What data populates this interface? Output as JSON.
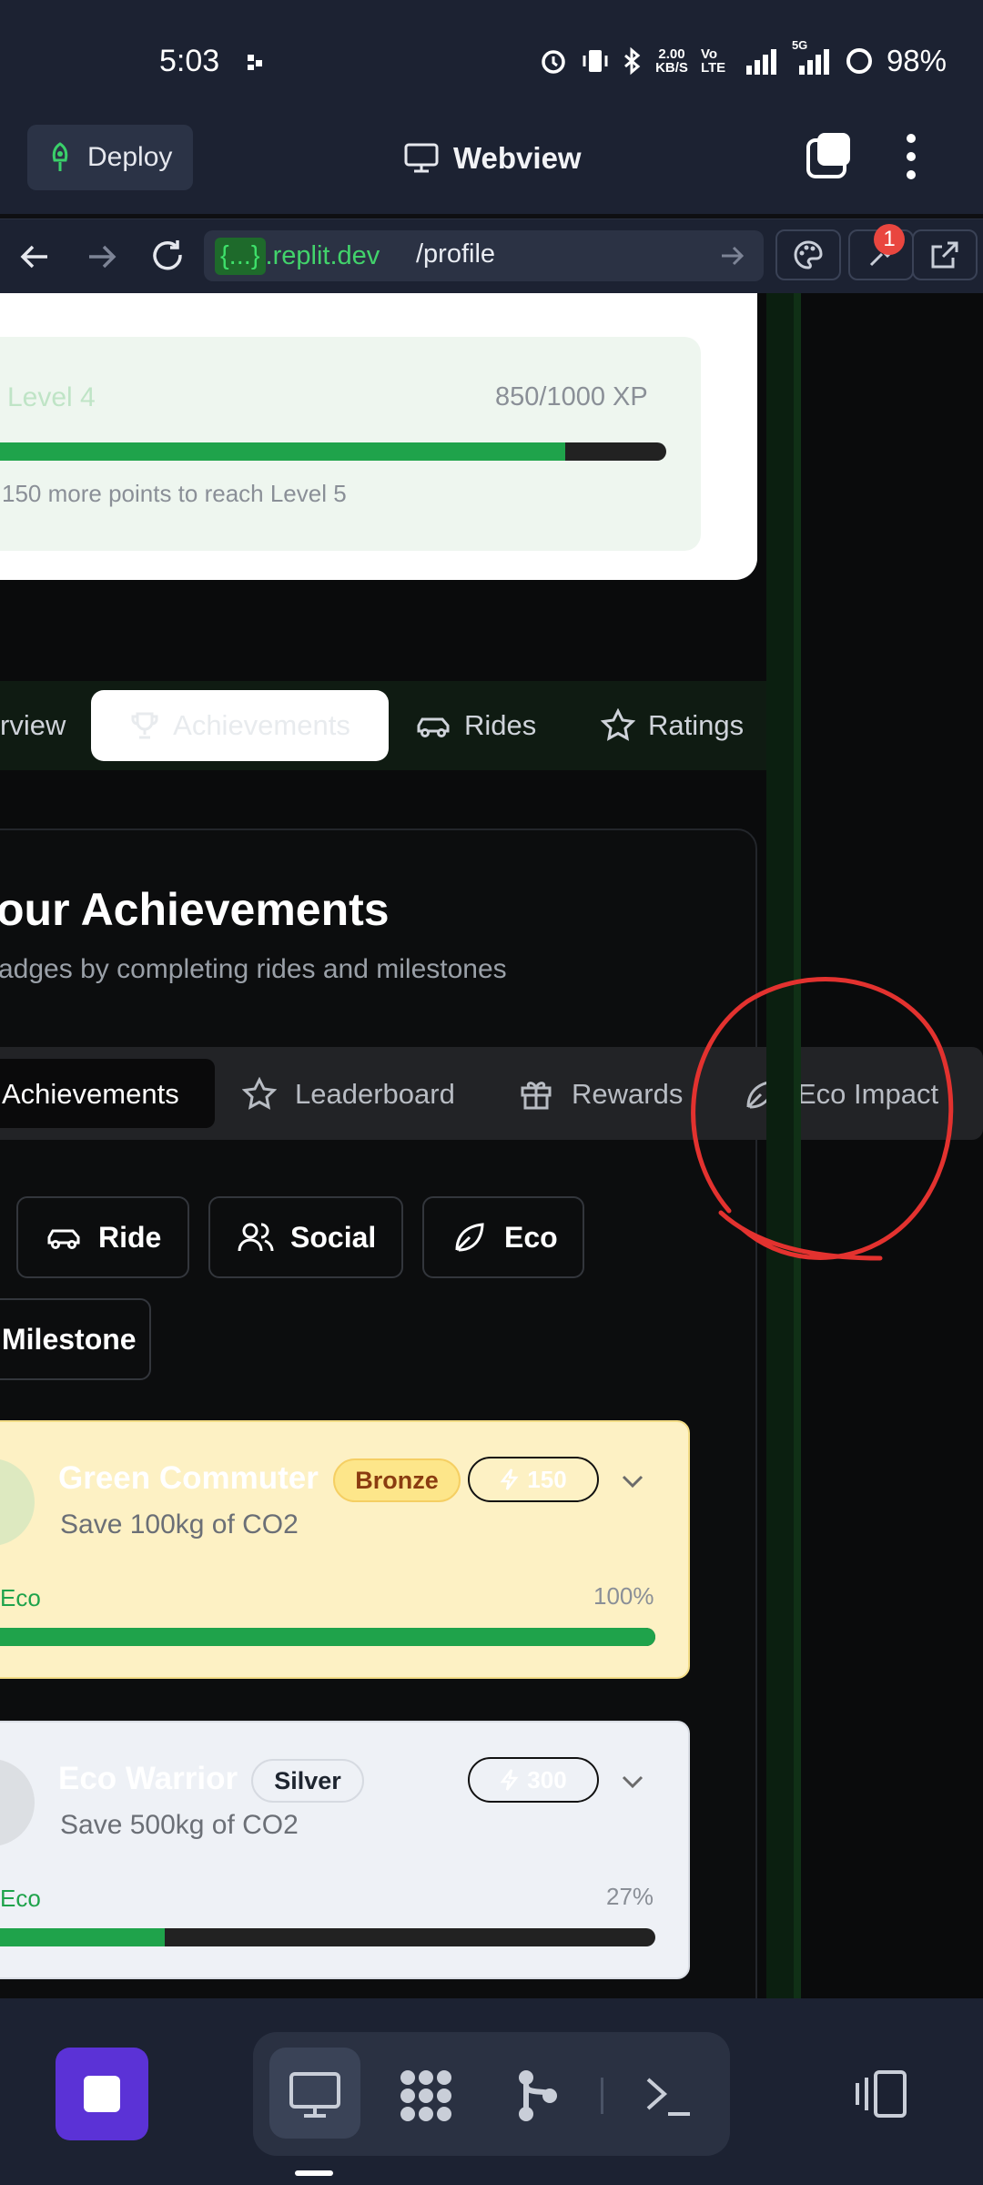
{
  "status_bar": {
    "time": "5:03",
    "net_speed": "2.00",
    "net_unit": "KB/S",
    "volte": "Vo LTE",
    "fiveg": "5G",
    "battery": "98%"
  },
  "app_bar": {
    "deploy_label": "Deploy",
    "title": "Webview"
  },
  "url_bar": {
    "host_brace": "{...}",
    "host_domain": ".replit.dev",
    "path": "/profile",
    "notification_count": "1"
  },
  "level_card": {
    "level": "Level 4",
    "xp": "850/1000 XP",
    "progress": 0.85,
    "note": "150 more points to reach Level 5"
  },
  "profile_tabs": [
    {
      "label": "rview"
    },
    {
      "label": "Achievements",
      "active": true
    },
    {
      "label": "Rides"
    },
    {
      "label": "Ratings"
    }
  ],
  "achievements_card": {
    "title": "our Achievements",
    "subtitle": "adges by completing rides and milestones"
  },
  "sub_tabs": [
    {
      "label": "Achievements",
      "active": true
    },
    {
      "label": "Leaderboard"
    },
    {
      "label": "Rewards"
    },
    {
      "label": "Eco Impact"
    }
  ],
  "filters": [
    {
      "label": "Ride",
      "icon": "car-icon"
    },
    {
      "label": "Social",
      "icon": "users-icon"
    },
    {
      "label": "Eco",
      "icon": "leaf-icon"
    },
    {
      "label": "Milestone",
      "icon": ""
    }
  ],
  "achievements": [
    {
      "title": "Green Commuter",
      "tier": "Bronze",
      "points": "150",
      "description": "Save 100kg of CO2",
      "category": "Eco",
      "percent_label": "100%",
      "progress": 1.0
    },
    {
      "title": "Eco Warrior",
      "tier": "Silver",
      "points": "300",
      "description": "Save 500kg of CO2",
      "category": "Eco",
      "percent_label": "27%",
      "progress": 0.27
    }
  ],
  "colors": {
    "accent_green": "#1fa34b",
    "bronze_bg": "#fdf1c4",
    "silver_bg": "#eef1f6",
    "annotation_red": "#e3322f",
    "brand_purple": "#5b32d6"
  }
}
